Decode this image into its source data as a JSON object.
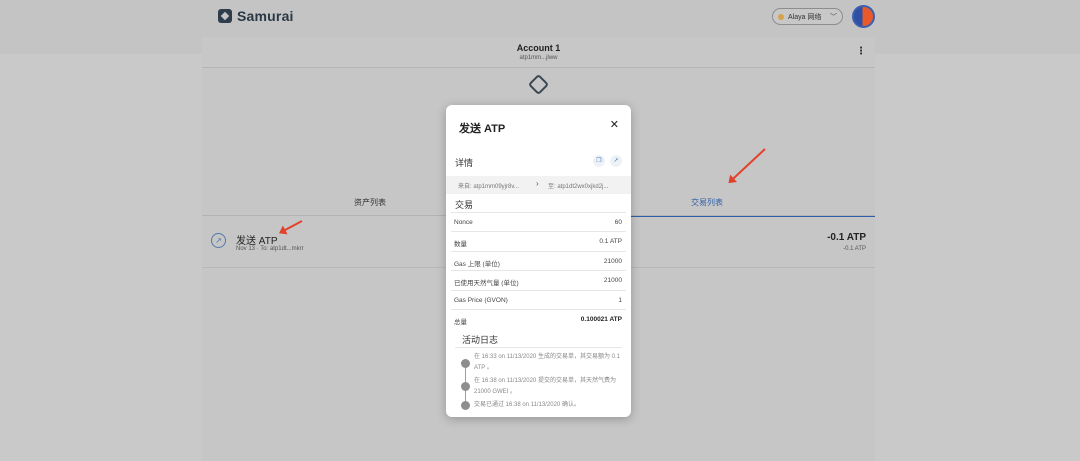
{
  "app": {
    "name": "Samurai"
  },
  "network": {
    "label": "Alaya 网络",
    "dot_color": "#d4a34a"
  },
  "account": {
    "name": "Account 1",
    "address_short": "atp1mm...jlww"
  },
  "tabs": [
    {
      "label": "资产列表",
      "active": false
    },
    {
      "label": "交易列表",
      "active": true
    }
  ],
  "transaction_row": {
    "title": "发送 ATP",
    "subtitle": "Nov 13 · To: atp1dt...mkrr",
    "amount": "-0.1 ATP",
    "amount_secondary": "-0.1 ATP"
  },
  "modal": {
    "title": "发送 ATP",
    "details_label": "详情",
    "from": "来自: atp1mm09yjr8v...",
    "to": "至: atp1dt2wx0xjkd2j...",
    "section_label": "交易",
    "rows": [
      {
        "key": "Nonce",
        "value": "60"
      },
      {
        "key": "数量",
        "value": "0.1 ATP"
      },
      {
        "key": "Gas 上限 (单位)",
        "value": "21000"
      },
      {
        "key": "已使用天然气量 (单位)",
        "value": "21000"
      },
      {
        "key": "Gas Price (GVON)",
        "value": "1"
      },
      {
        "key": "总量",
        "value": "0.100021 ATP"
      }
    ],
    "activity_label": "活动日志",
    "activity": [
      "在 16:33 on 11/13/2020 生成的交易单，其交易额为 0.1 ATP 。",
      "在 16:38 on 11/13/2020 提交的交易单，其天然气费为 21000 GWEI 。",
      "交易已通过 16:38 on 11/13/2020 确认。"
    ]
  },
  "colors": {
    "accent": "#2f5fa8",
    "annotation_arrow": "#e2412b"
  }
}
